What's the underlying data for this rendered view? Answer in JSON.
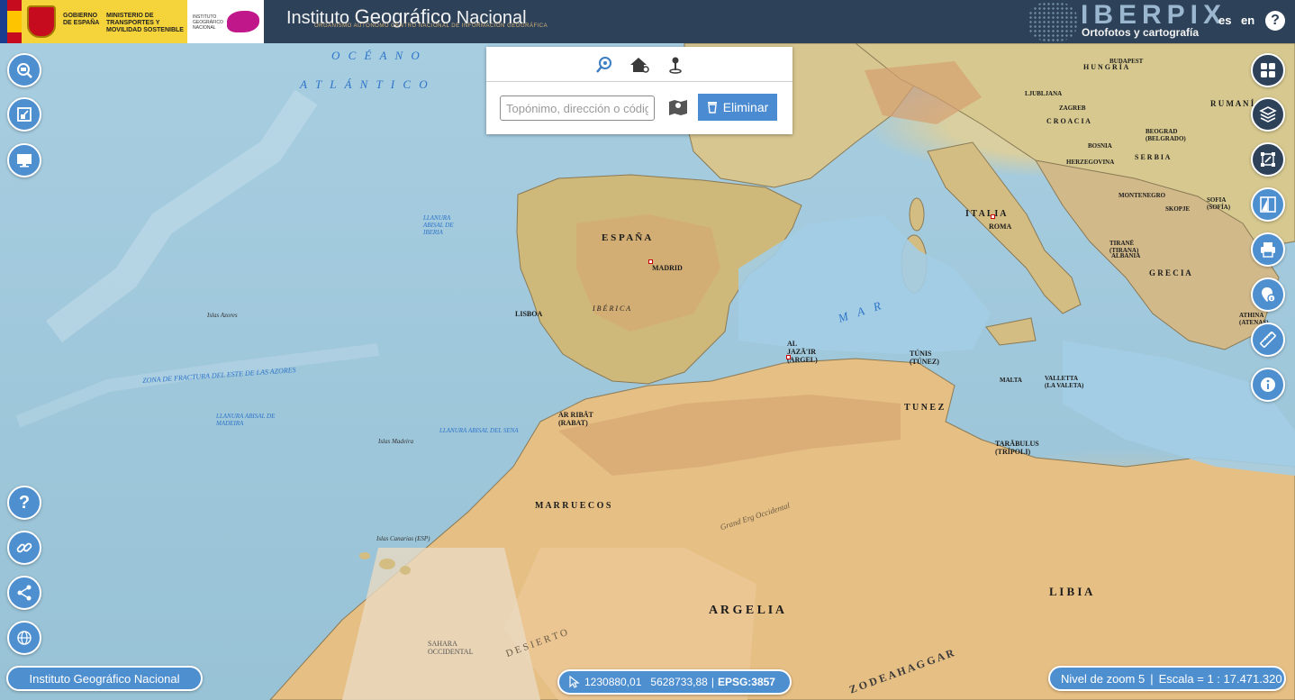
{
  "header": {
    "gov_line1": "GOBIERNO DE ESPAÑA",
    "gov_line2": "MINISTERIO DE TRANSPORTES Y MOVILIDAD SOSTENIBLE",
    "ign_small": "INSTITUTO GEOGRÁFICO NACIONAL",
    "title_part1": "Instituto ",
    "title_part2": "Geográfico",
    "title_part3": " Nacional",
    "subtitle": "ORGANISMO AUTÓNOMO CENTRO NACIONAL DE INFORMACIÓN GEOGRÁFICA",
    "app_name": "IBERPIX",
    "app_subtitle": "Ortofotos y cartografía",
    "lang_es": "es",
    "lang_en": "en",
    "help": "?"
  },
  "search": {
    "placeholder": "Topónimo, dirección o código postal",
    "delete_label": "Eliminar",
    "tabs": [
      "search-place-icon",
      "house-search-icon",
      "location-pin-icon"
    ]
  },
  "left_buttons": [
    "zoom-icon",
    "extent-icon",
    "screen-icon"
  ],
  "left_bottom_buttons": [
    "help-icon",
    "link-icon",
    "share-icon",
    "globe-icon"
  ],
  "right_buttons": [
    "grid-icon",
    "layers-icon",
    "draw-icon",
    "compare-icon",
    "print-icon",
    "info-pin-icon",
    "measure-icon",
    "info-icon"
  ],
  "footer": {
    "attribution": "Instituto Geográfico Nacional",
    "coord_x": "1230880,01",
    "coord_y": "5628733,88",
    "separator": "|",
    "epsg": "EPSG:3857",
    "zoom_label": "Nivel de zoom 5",
    "scale_label": "Escala = 1 : 17.471.320"
  },
  "map_labels": {
    "espana": "E S P A Ñ A",
    "madrid": "MADRID",
    "lisboa": "LISBOA",
    "iberica": "I B É R I C A",
    "italia": "I T A L I A",
    "roma": "ROMA",
    "argelia": "A R G E L I A",
    "libia": "L I B I A",
    "tunez": "T U N E Z",
    "marruecos": "M A R R U E C O S",
    "rabat": "AR RIBĀT (RABAT)",
    "argel": "AL JAZĀ'IR (ARGEL)",
    "tunis": "TÚNIS (TÚNEZ)",
    "tripoli": "TARĀBULUS (TRÍPOLI)",
    "sahara": "SAHARA OCCIDENTAL",
    "hungria": "H U N G R Í A",
    "croacia": "C R O A C I A",
    "rumania": "R U M A N Í A",
    "serbia": "S E R B I A",
    "grecia": "G R E C I A",
    "albania": "ALBANIA",
    "bosnia": "BOSNIA",
    "herzegovina": "HERZEGOVINA",
    "montenegro": "MONTENEGRO",
    "beograd": "BEOGRAD (BELGRADO)",
    "skopje": "SKOPJE",
    "sofia": "SOFIA (SOFÍA)",
    "tirane": "TIRANË (TIRANA)",
    "athina": "ATHINA (ATENAS)",
    "valletta": "VALLETTA (LA VALETA)",
    "malta": "MALTA",
    "zagreb": "ZAGREB",
    "ljubljana": "LJUBLJANA",
    "budapest": "BUDAPEST",
    "oceano": "O C É A N O",
    "atlantico": "A T L Á N T I C O",
    "mar": "M A R",
    "fractura": "ZONA DE FRACTURA DEL ESTE DE LAS AZORES",
    "llanura_iberia": "LLANURA ABISAL DE IBERIA",
    "llanura_madeira": "LLANURA ABISAL DE MADEIRA",
    "llanura_sena": "LLANURA ABISAL DEL SENA",
    "azores": "Islas Azores",
    "madeira": "Islas Madeira",
    "canarias": "Islas Canarias (ESP)",
    "hoggar": "Z O  D E  A H A G G A R",
    "desierto": "D E S I E R T O",
    "gran_erg": "Grand Erg Occidental"
  }
}
